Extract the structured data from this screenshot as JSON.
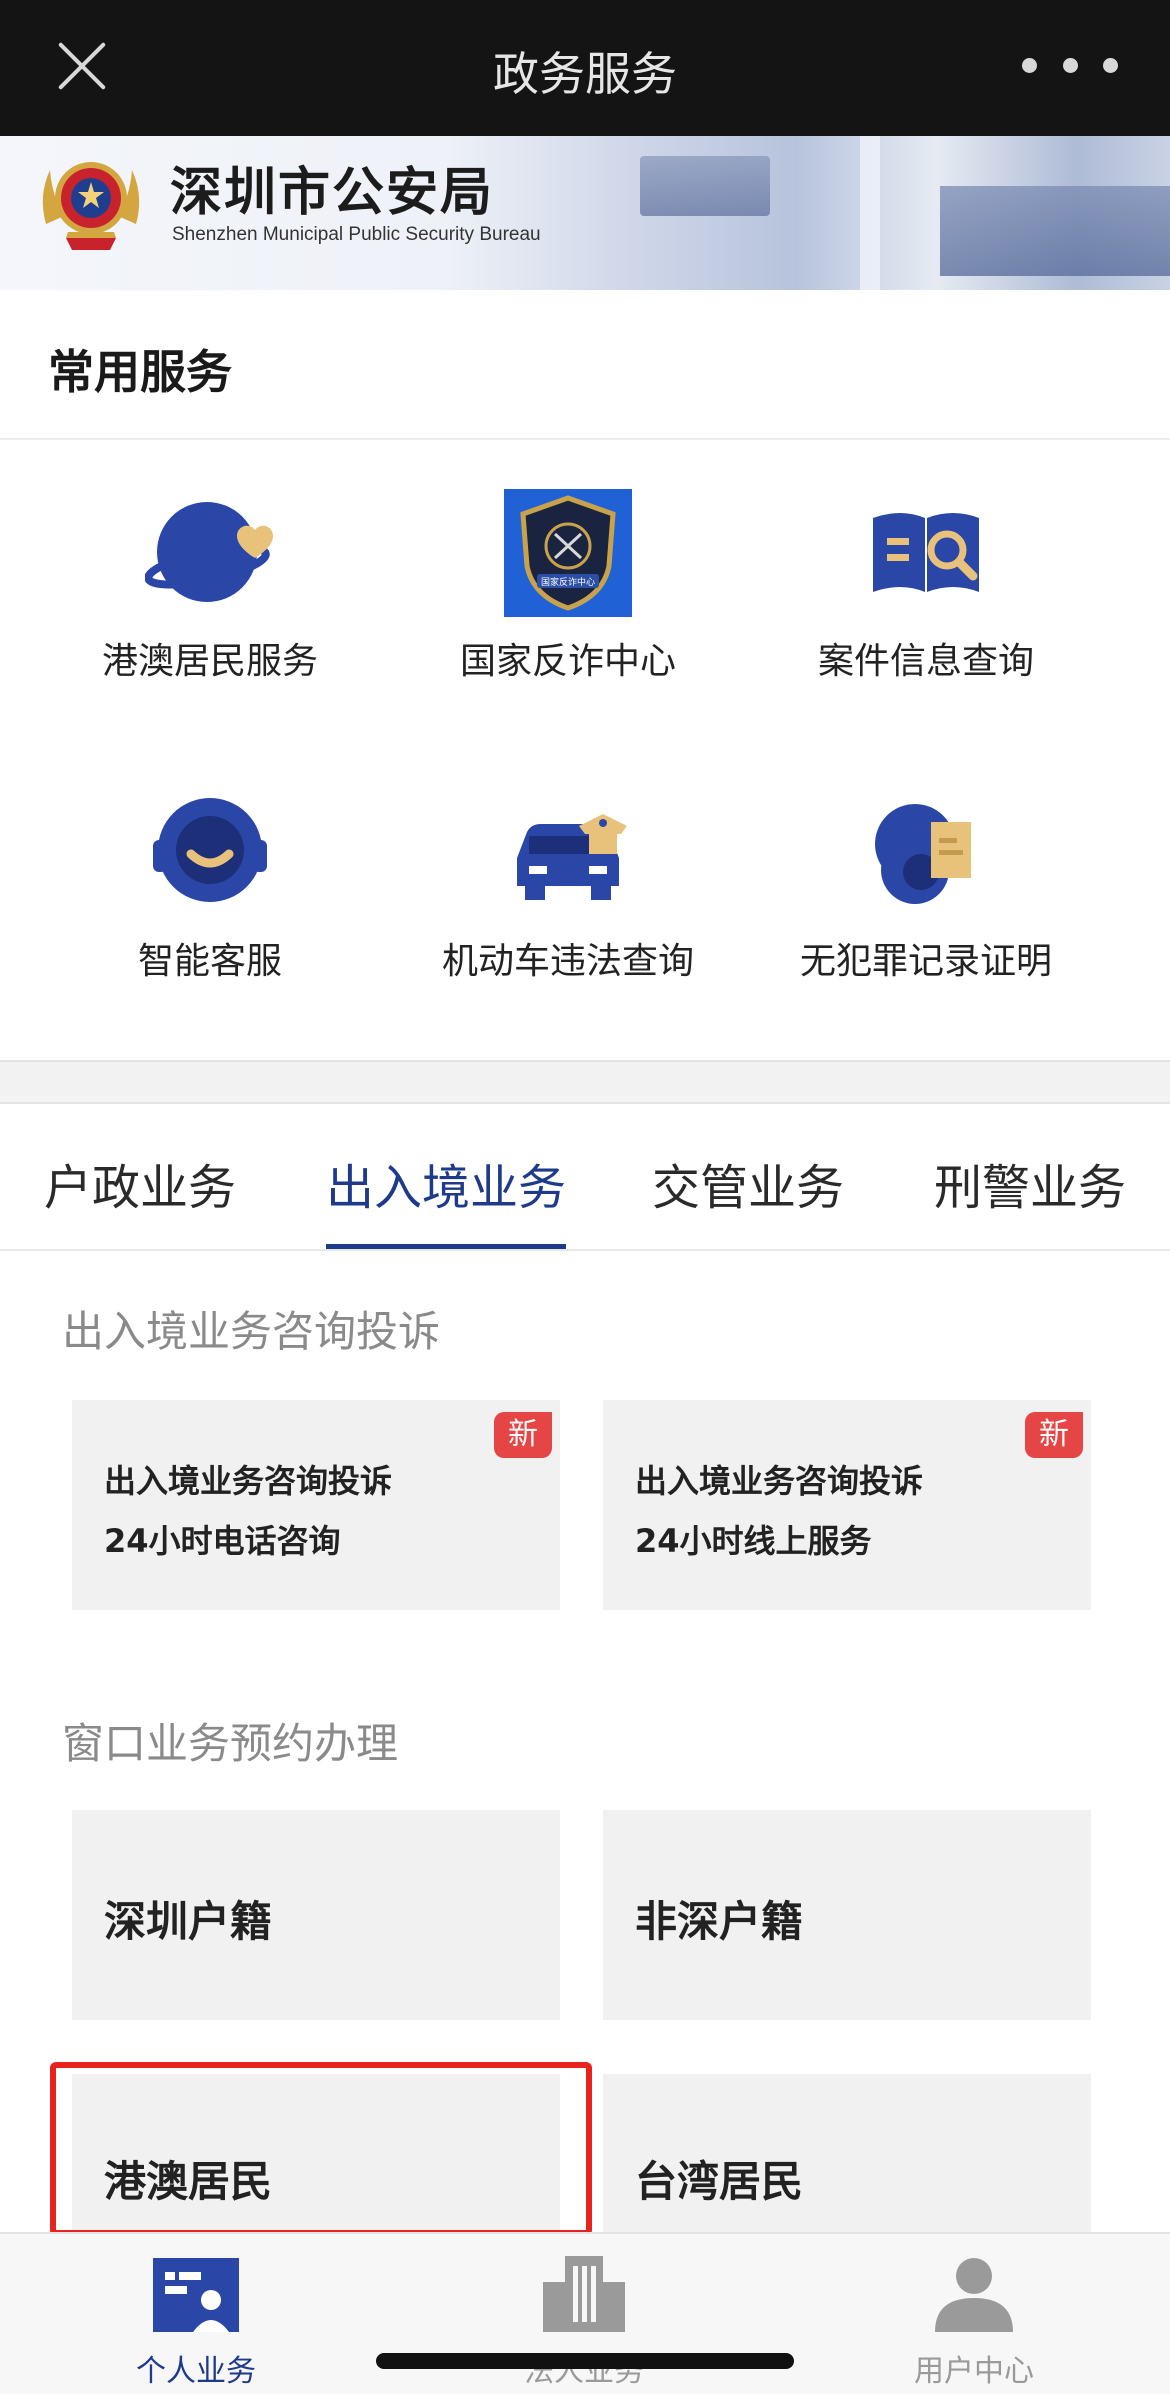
{
  "header": {
    "title": "政务服务",
    "close_icon": "close-icon",
    "more_icon": "more-icon"
  },
  "banner": {
    "name_zh": "深圳市公安局",
    "name_en": "Shenzhen Municipal Public Security Bureau"
  },
  "common_services": {
    "title": "常用服务",
    "items": [
      {
        "label": "港澳居民服务",
        "icon": "globe-heart-icon"
      },
      {
        "label": "国家反诈中心",
        "icon": "anti-fraud-shield-icon",
        "icon_text": "国家反诈中心"
      },
      {
        "label": "案件信息查询",
        "icon": "book-search-icon"
      },
      {
        "label": "智能客服",
        "icon": "headset-icon"
      },
      {
        "label": "机动车违法查询",
        "icon": "car-officer-icon"
      },
      {
        "label": "无犯罪记录证明",
        "icon": "certificate-icon"
      }
    ]
  },
  "tabs": [
    {
      "label": "户政业务",
      "active": false
    },
    {
      "label": "出入境业务",
      "active": true
    },
    {
      "label": "交管业务",
      "active": false
    },
    {
      "label": "刑警业务",
      "active": false
    }
  ],
  "groups": [
    {
      "title": "出入境业务咨询投诉",
      "cards": [
        {
          "line1": "出入境业务咨询投诉",
          "line2": "24小时电话咨询",
          "badge": "新"
        },
        {
          "line1": "出入境业务咨询投诉",
          "line2": "24小时线上服务",
          "badge": "新"
        }
      ]
    },
    {
      "title": "窗口业务预约办理",
      "cards": [
        {
          "label": "深圳户籍"
        },
        {
          "label": "非深户籍"
        },
        {
          "label": "港澳居民",
          "highlighted": true
        },
        {
          "label": "台湾居民"
        }
      ]
    }
  ],
  "bottom_nav": [
    {
      "label": "个人业务",
      "icon": "person-card-icon",
      "active": true
    },
    {
      "label": "法人业务",
      "icon": "building-icon",
      "active": false
    },
    {
      "label": "用户中心",
      "icon": "user-icon",
      "active": false
    }
  ],
  "colors": {
    "accent": "#1e3a8a",
    "icon_blue": "#2a46a6",
    "icon_gold": "#e8c27a",
    "badge_red": "#e64545",
    "highlight_red": "#e8231d"
  }
}
